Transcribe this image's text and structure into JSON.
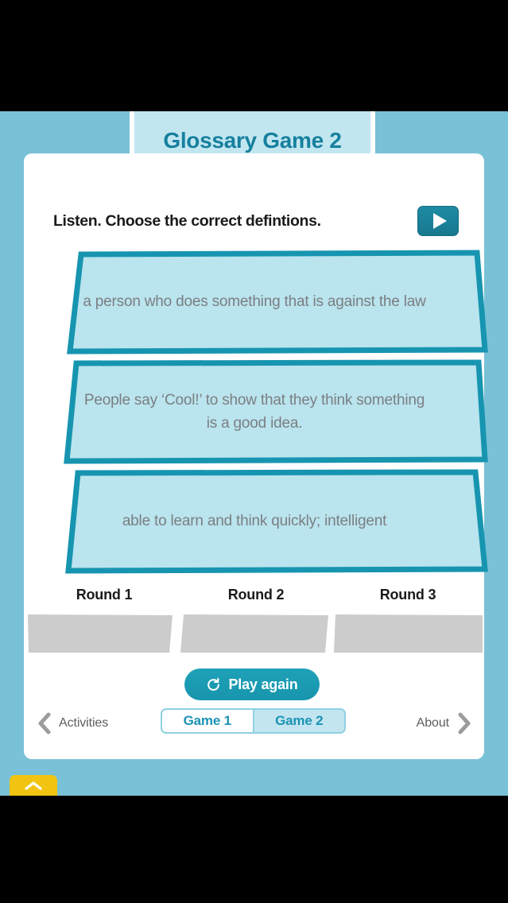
{
  "app": {
    "title": "Glossary Game 2",
    "background_color": "#79c1d6",
    "accent_color": "#16809e"
  },
  "instruction": {
    "text": "Listen. Choose the correct defintions.",
    "play_icon": "play-icon"
  },
  "cards": [
    {
      "text": "a person who does something that is against the law"
    },
    {
      "text": "People say ‘Cool!’ to show that they think something is a good idea."
    },
    {
      "text": "able to learn and think quickly; intelligent"
    }
  ],
  "rounds": [
    {
      "label": "Round 1",
      "value": ""
    },
    {
      "label": "Round 2",
      "value": ""
    },
    {
      "label": "Round 3",
      "value": ""
    }
  ],
  "play_again": {
    "label": "Play again",
    "icon": "refresh-icon"
  },
  "bottom_nav": {
    "prev": {
      "label": "Activities",
      "icon": "chevron-left-icon"
    },
    "next": {
      "label": "About",
      "icon": "chevron-right-icon"
    },
    "tabs": [
      {
        "label": "Game 1",
        "active": false
      },
      {
        "label": "Game 2",
        "active": true
      }
    ]
  },
  "pull_tab": {
    "icon": "chevron-up-icon",
    "color": "#f0c411"
  }
}
